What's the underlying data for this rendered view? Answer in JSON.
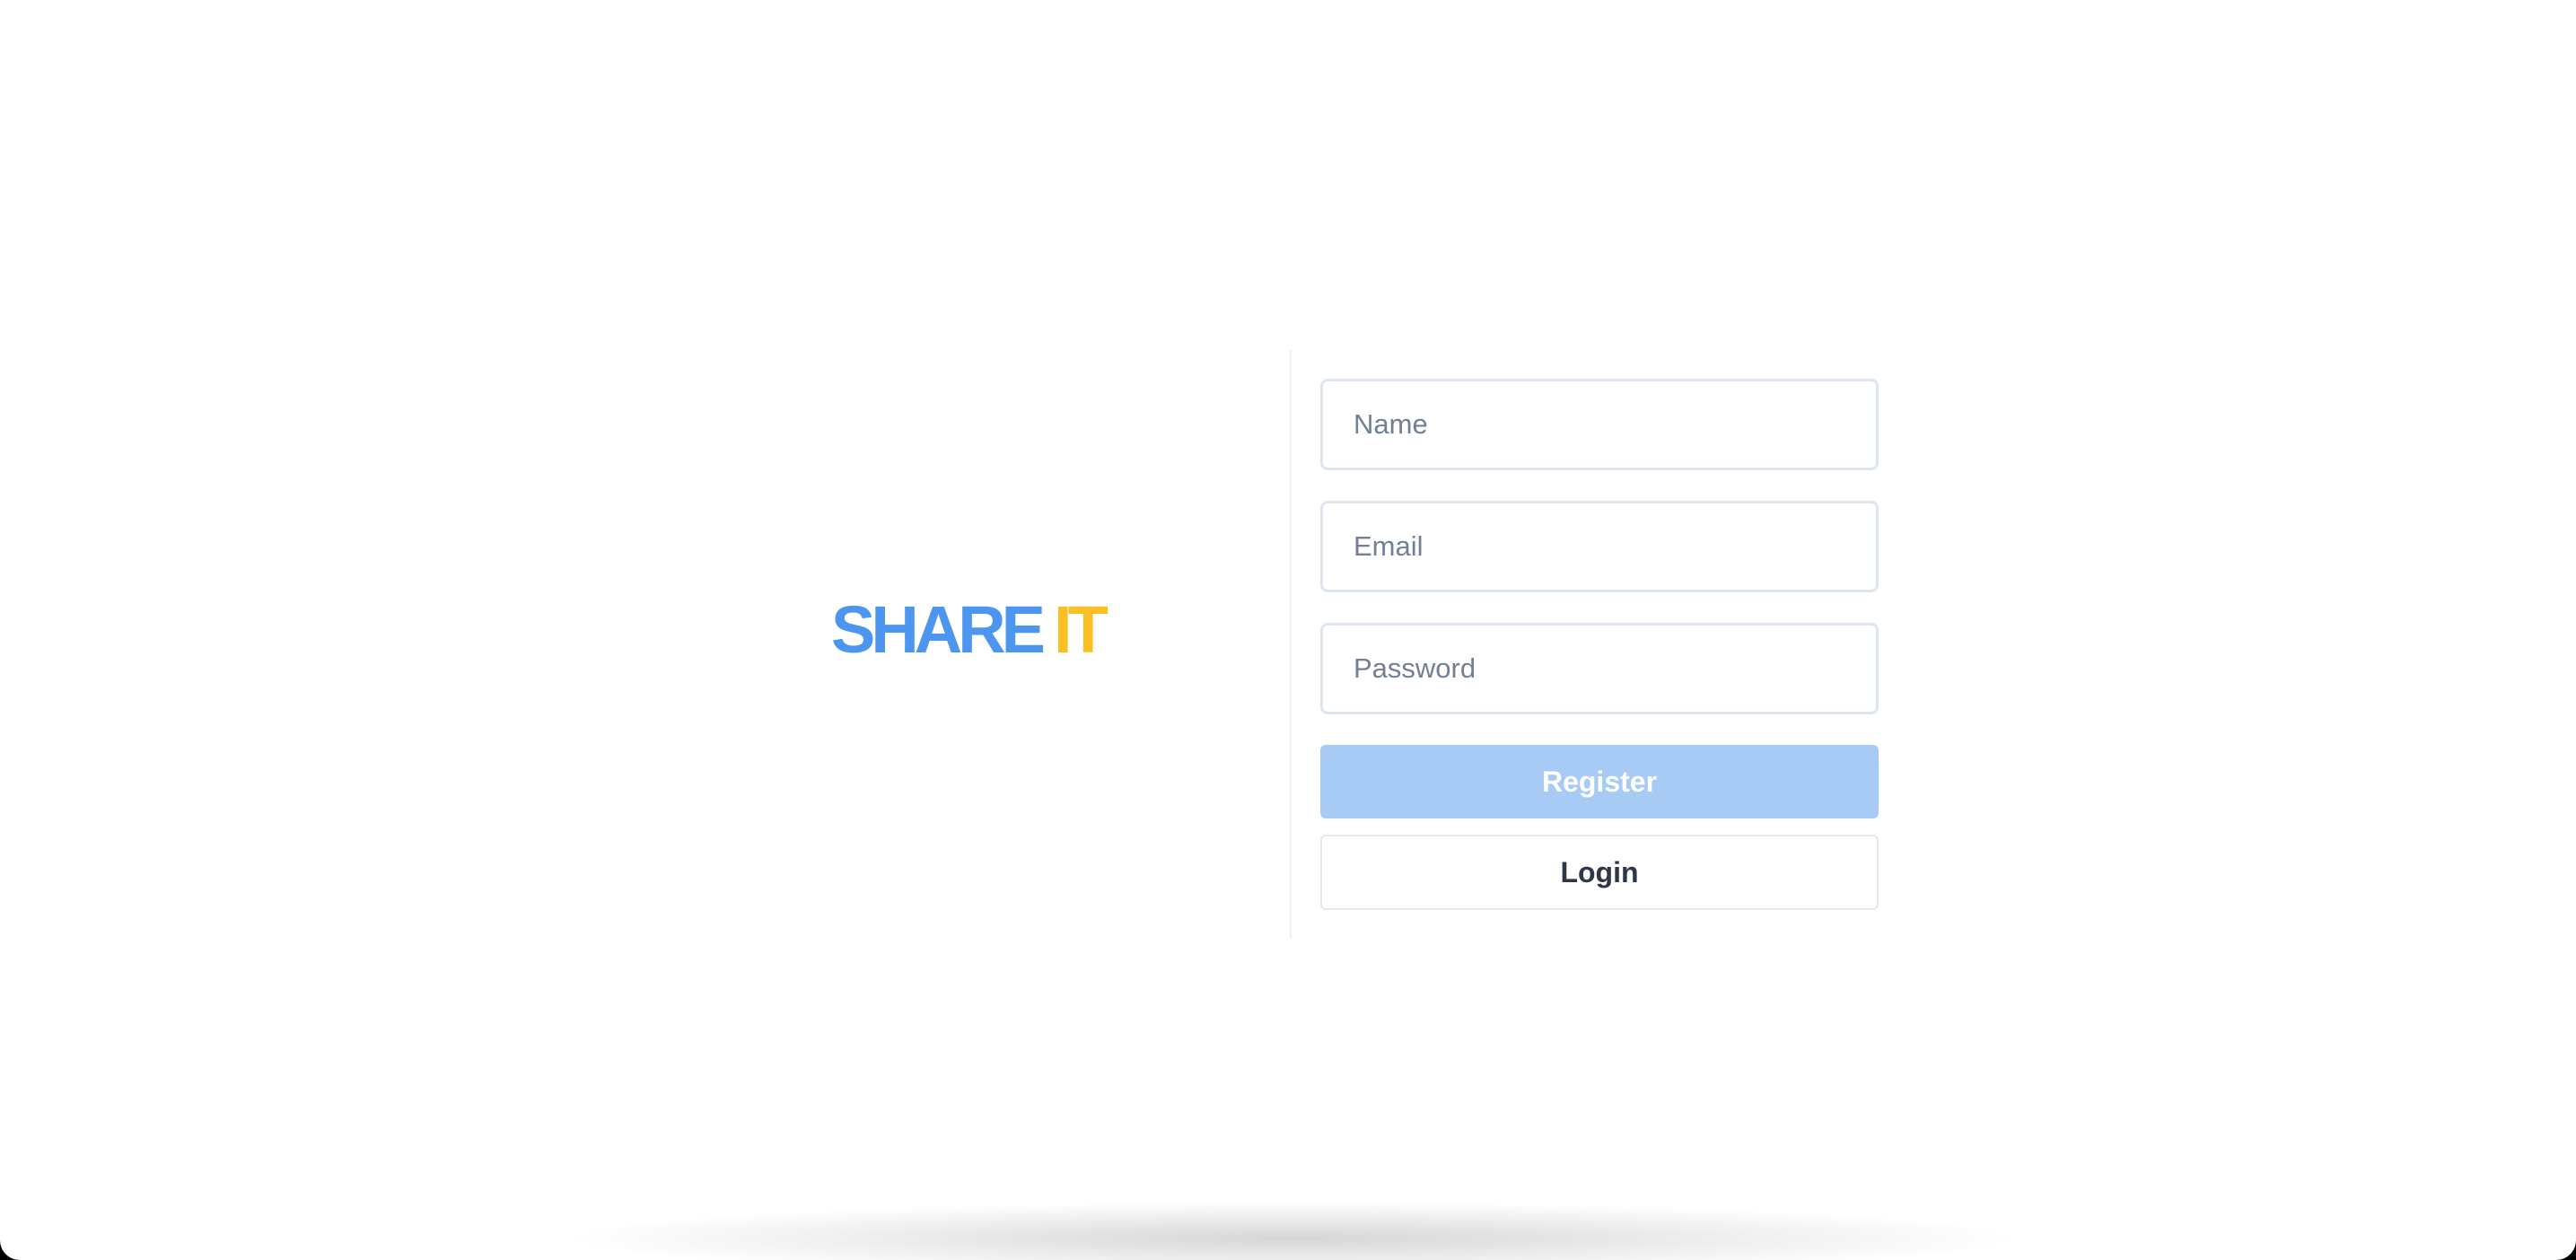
{
  "brand": {
    "word_1": "SHARE",
    "word_2": "IT",
    "colors": {
      "word_1": "#4d96ef",
      "word_2": "#fbbf24"
    }
  },
  "form": {
    "name_placeholder": "Name",
    "email_placeholder": "Email",
    "password_placeholder": "Password",
    "register_label": "Register",
    "login_label": "Login"
  },
  "colors": {
    "register_button_bg": "#a8cbf6",
    "login_button_text": "#2d3748",
    "field_border": "#dde5ee",
    "placeholder_text": "#718096"
  }
}
